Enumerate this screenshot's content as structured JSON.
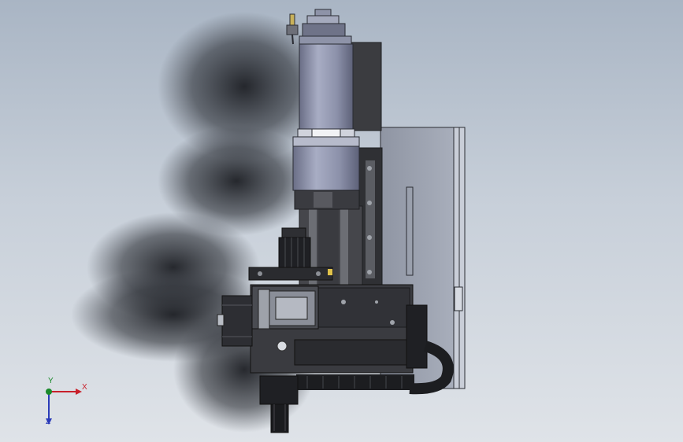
{
  "viewport": {
    "background_top": "#a9b5c4",
    "background_bottom": "#dfe3e8"
  },
  "triad": {
    "x_label": "X",
    "y_label": "Y",
    "z_label": "Z",
    "x_color": "#c8202a",
    "y_color": "#1b8a2c",
    "z_color": "#2a3bb8"
  },
  "model": {
    "motor_color": "#8a8fa8",
    "frame_color": "#3d3d40",
    "plate_color": "#9aa0ad"
  }
}
